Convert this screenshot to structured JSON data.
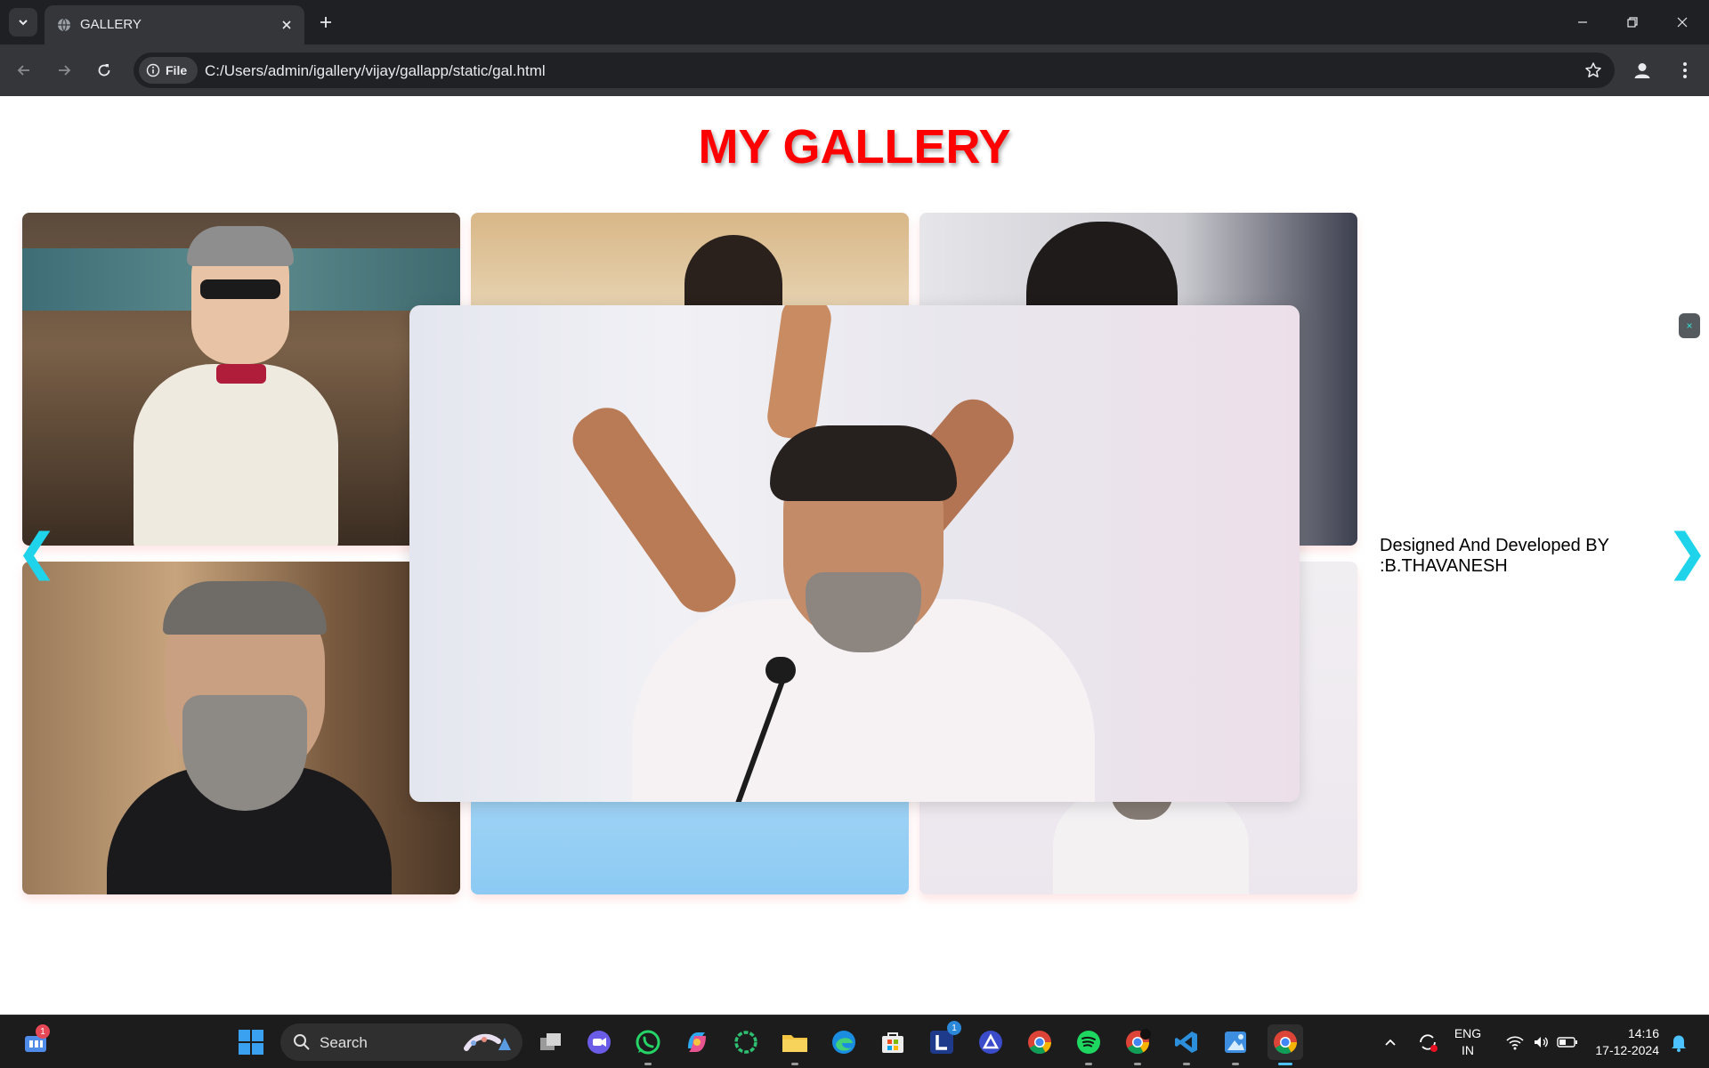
{
  "browser": {
    "tab_title": "GALLERY",
    "address_chip": "File",
    "url": "C:/Users/admin/igallery/vijay/gallapp/static/gal.html"
  },
  "page": {
    "title": "MY GALLERY",
    "credit_line1": "Designed And Developed BY",
    "credit_line2": ":B.THAVANESH",
    "prev_arrow": "❮",
    "next_arrow": "❯",
    "close_symbol": "×"
  },
  "gallery": {
    "tiles": [
      {
        "subject": "man in white suit with sunglasses"
      },
      {
        "subject": "man against light background"
      },
      {
        "subject": "man in dark setting"
      },
      {
        "subject": "bearded man smiling in black shirt"
      },
      {
        "subject": "man against blue background"
      },
      {
        "subject": "man at microphone in white shirt"
      }
    ],
    "lightbox_subject": "smiling man with hands joined overhead at a microphone"
  },
  "taskbar": {
    "search_label": "Search",
    "teams_badge": "1",
    "l_badge": "1",
    "language_line1": "ENG",
    "language_line2": "IN",
    "time": "14:16",
    "date": "17-12-2024"
  },
  "colors": {
    "title": "#ff0000",
    "arrow": "#1fd3ea",
    "chrome_dark": "#1f2023",
    "chrome_toolbar": "#35363a",
    "taskbar": "#1c1c1c"
  }
}
